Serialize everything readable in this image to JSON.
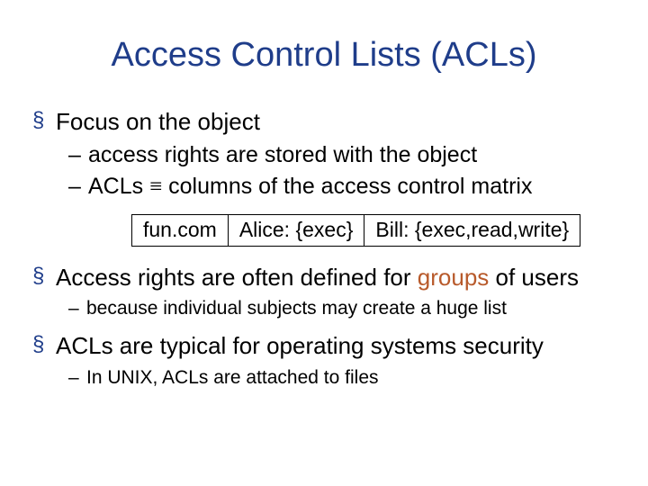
{
  "title": "Access Control Lists (ACLs)",
  "bullets": {
    "b1": {
      "text": "Focus on the object",
      "sub": {
        "s1": "access rights are stored with the object",
        "s2_pre": "ACLs ",
        "s2_sym": "≡",
        "s2_post": " columns of the access control matrix"
      }
    },
    "acl_row": {
      "c1": "fun.com",
      "c2": "Alice: {exec}",
      "c3": "Bill: {exec,read,write}"
    },
    "b2": {
      "pre": "Access rights are often defined for ",
      "accent": "groups",
      "post": " of users",
      "sub": {
        "s1": "because individual subjects may create a huge list"
      }
    },
    "b3": {
      "text": "ACLs are typical for operating systems security",
      "sub": {
        "s1": "In UNIX, ACLs are attached to files"
      }
    }
  }
}
